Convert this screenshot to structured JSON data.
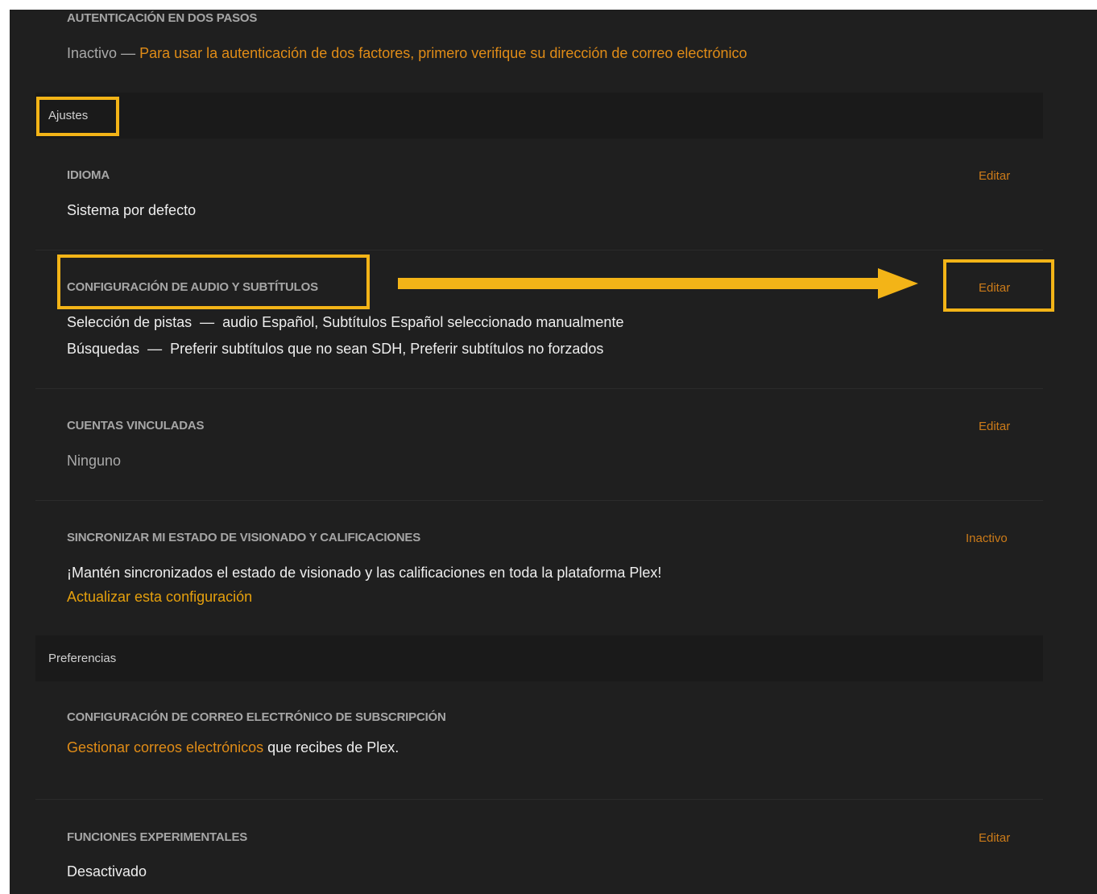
{
  "two_factor": {
    "title": "AUTENTICACIÓN EN DOS PASOS",
    "status": "Inactivo",
    "separator": "—",
    "message": "Para usar la autenticación de dos factores, primero verifique su dirección de correo electrónico"
  },
  "sections": {
    "ajustes": "Ajustes",
    "preferencias": "Preferencias"
  },
  "language": {
    "title": "IDIOMA",
    "value": "Sistema por defecto",
    "edit_label": "Editar"
  },
  "audio_subtitles": {
    "title": "CONFIGURACIÓN DE AUDIO Y SUBTÍTULOS",
    "edit_label": "Editar",
    "line1_label": "Selección de pistas",
    "line1_sep": "—",
    "line1_value": "audio Español, Subtítulos Español seleccionado manualmente",
    "line2_label": "Búsquedas",
    "line2_sep": "—",
    "line2_value": "Preferir subtítulos que no sean SDH, Preferir subtítulos no forzados"
  },
  "linked_accounts": {
    "title": "CUENTAS VINCULADAS",
    "value": "Ninguno",
    "edit_label": "Editar"
  },
  "sync": {
    "title": "SINCRONIZAR MI ESTADO DE VISIONADO Y CALIFICACIONES",
    "status": "Inactivo",
    "description": "¡Mantén sincronizados el estado de visionado y las calificaciones en toda la plataforma Plex!",
    "link": "Actualizar esta configuración"
  },
  "subscription_email": {
    "title": "CONFIGURACIÓN DE CORREO ELECTRÓNICO DE SUBSCRIPCIÓN",
    "link": "Gestionar correos electrónicos",
    "suffix": "que recibes de Plex."
  },
  "experimental": {
    "title": "FUNCIONES EXPERIMENTALES",
    "value": "Desactivado",
    "edit_label": "Editar"
  },
  "colors": {
    "background": "#1f1f1f",
    "section_bar": "#1a1a1a",
    "accent": "#e5a00d",
    "edit": "#cc7b19",
    "highlight": "#f3b417"
  }
}
